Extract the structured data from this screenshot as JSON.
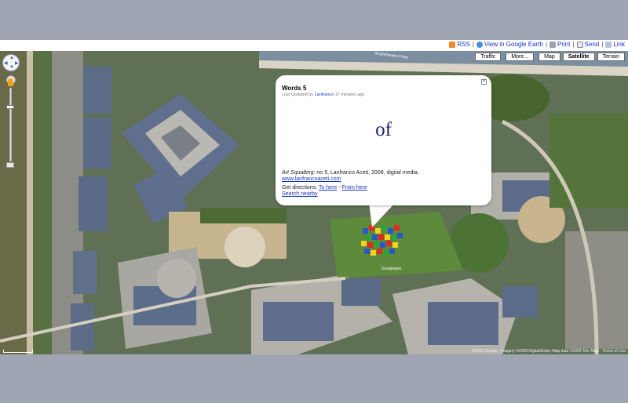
{
  "toolbar": {
    "rss": "RSS",
    "earth": "View in Google Earth",
    "print": "Print",
    "send": "Send",
    "link": "Link"
  },
  "icons": {
    "rss": "rss-icon",
    "earth": "google-earth-icon",
    "print": "printer-icon",
    "send": "envelope-icon",
    "link": "chain-link-icon"
  },
  "map_types": {
    "traffic": "Traffic",
    "more": "More...",
    "map": "Map",
    "satellite": "Satellite",
    "terrain": "Terrain",
    "selected": "Satellite"
  },
  "map_labels": {
    "road": "Amphitheatre Pkwy",
    "place": "Googleplex",
    "copyright": "©2009 Google - Imagery ©2009 DigitalGlobe, Map data ©2009 Tele Atlas - Terms of Use"
  },
  "info_window": {
    "title": "Words 5",
    "updated_prefix": "Last Updated by ",
    "updated_author": "Lanfranco",
    "updated_suffix": " 17 minutes ago",
    "word": "of",
    "desc_italic": "Art Squatting: no 5",
    "desc_rest": ", Lanfranco Aceti, 2008, digital media.",
    "link": "www.lanfrancoaceti.com",
    "directions_label": "Get directions: ",
    "to_here": "To here",
    "dash": " - ",
    "from_here": "From here",
    "search_nearby": "Search nearby"
  },
  "colors": {
    "link": "#1a35c8",
    "word": "#1d1f6e",
    "frame": "#a0a5b3"
  }
}
